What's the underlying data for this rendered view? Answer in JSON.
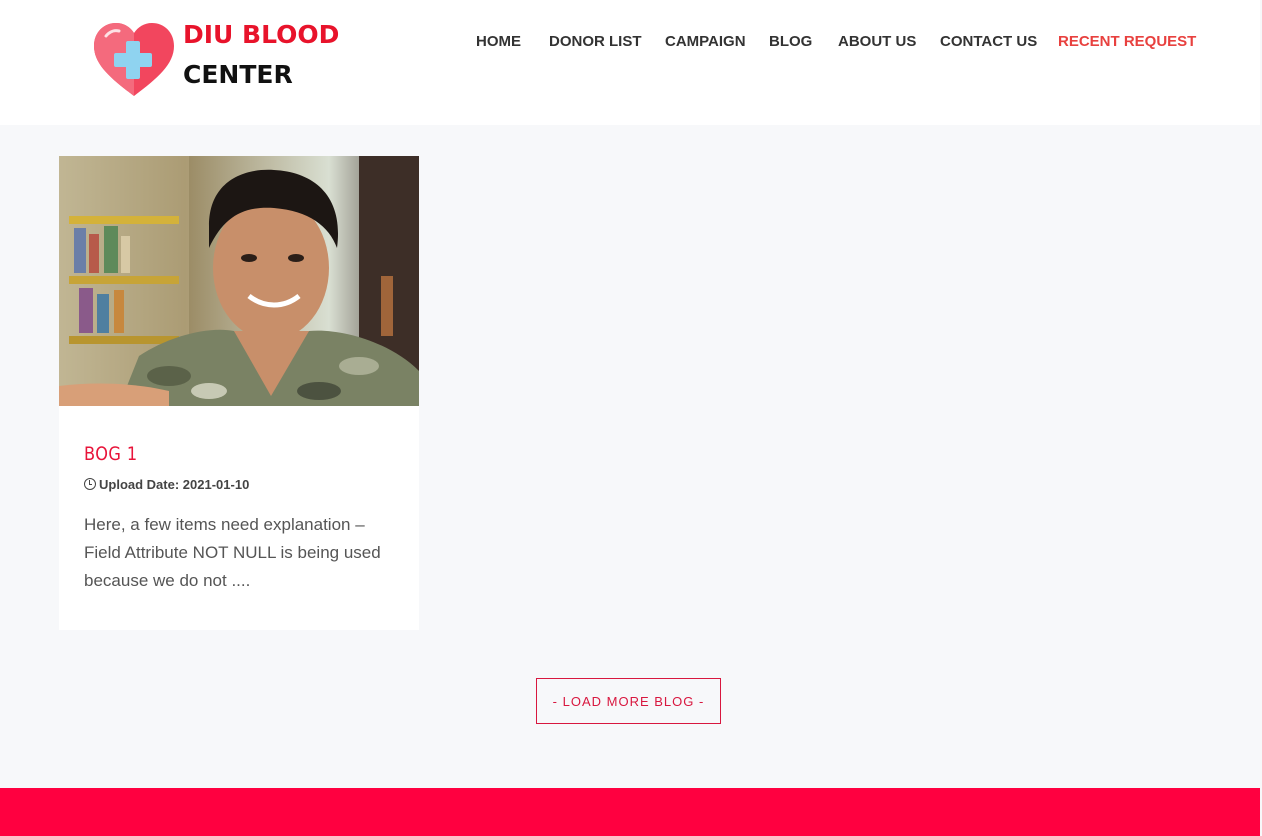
{
  "brand": {
    "line1": "DIU BLOOD",
    "line2": "CENTER"
  },
  "nav": {
    "home": "HOME",
    "donor_list": "DONOR LIST",
    "campaign": "CAMPAIGN",
    "blog": "BLOG",
    "about": "ABOUT US",
    "contact": "CONTACT US",
    "recent": "RECENT REQUEST"
  },
  "colors": {
    "accent": "#e8132b",
    "nav_active": "#e8413f",
    "footer": "#ff0040",
    "background": "#f7f8fa"
  },
  "blog": {
    "posts": [
      {
        "title": "BOG 1",
        "date_label": "Upload Date:",
        "date": "2021-01-10",
        "excerpt": "Here, a few items need explanation – Field Attribute NOT NULL is being used because we do not ....",
        "icon": "clock-icon"
      }
    ],
    "load_more": "- LOAD MORE BLOG -"
  }
}
